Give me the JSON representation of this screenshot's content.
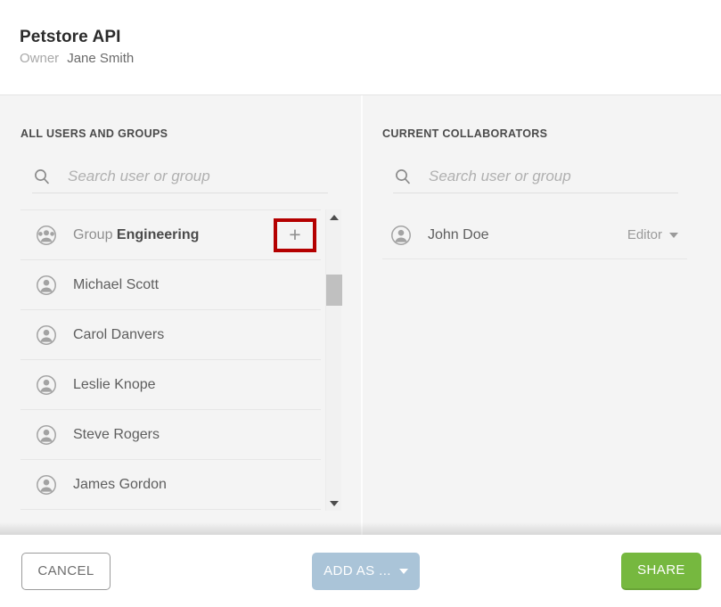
{
  "header": {
    "title": "Petstore API",
    "owner_label": "Owner",
    "owner_name": "Jane Smith"
  },
  "left_panel": {
    "heading": "ALL USERS AND GROUPS",
    "search": {
      "placeholder": "Search user or group",
      "value": "",
      "icon": "search-icon"
    },
    "rows": [
      {
        "type": "group",
        "icon": "group-avatar-icon",
        "prefix": "Group",
        "name": "Engineering",
        "add_label": "+",
        "highlighted": true
      },
      {
        "type": "user",
        "icon": "user-avatar-icon",
        "prefix": "",
        "name": "Michael Scott",
        "add_label": "+",
        "highlighted": false
      },
      {
        "type": "user",
        "icon": "user-avatar-icon",
        "prefix": "",
        "name": "Carol Danvers",
        "add_label": "+",
        "highlighted": false
      },
      {
        "type": "user",
        "icon": "user-avatar-icon",
        "prefix": "",
        "name": "Leslie Knope",
        "add_label": "+",
        "highlighted": false
      },
      {
        "type": "user",
        "icon": "user-avatar-icon",
        "prefix": "",
        "name": "Steve Rogers",
        "add_label": "+",
        "highlighted": false
      },
      {
        "type": "user",
        "icon": "user-avatar-icon",
        "prefix": "",
        "name": "James Gordon",
        "add_label": "+",
        "highlighted": false
      }
    ],
    "scrollbar": {
      "up_icon": "scroll-up-arrow-icon",
      "down_icon": "scroll-down-arrow-icon"
    }
  },
  "right_panel": {
    "heading": "CURRENT COLLABORATORS",
    "search": {
      "placeholder": "Search user or group",
      "value": "",
      "icon": "search-icon"
    },
    "collaborators": [
      {
        "icon": "user-avatar-icon",
        "name": "John Doe",
        "role": "Editor"
      }
    ]
  },
  "footer": {
    "cancel_label": "CANCEL",
    "add_as_label": "ADD AS ...",
    "share_label": "SHARE"
  },
  "colors": {
    "highlight": "#b40000",
    "share_green": "#76b83f",
    "add_as_blue": "#aac4d8",
    "body_bg": "#f4f4f4"
  }
}
